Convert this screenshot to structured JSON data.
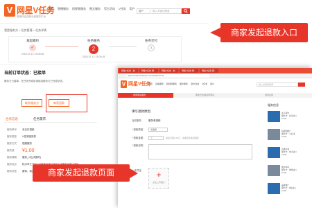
{
  "back": {
    "logo": {
      "badge": "V",
      "text": "网星V任务",
      "tagline": "新媒体自由职业者服务平台"
    },
    "nav": [
      "首页",
      "直播服务",
      "短视频服务",
      "图文服务",
      "官方活动",
      "V任务",
      "用户"
    ],
    "search": {
      "select": "用户",
      "placeholder": "输入关键词搜索"
    },
    "breadcrumb": "我是服务方 > 任务管理 > 任务详情",
    "steps": [
      {
        "title": "发起邀约",
        "num": "✓",
        "time": "2018-07-12 14:06:56",
        "state": "done"
      },
      {
        "title": "任务服务",
        "num": "2",
        "time": "2018-07-12 15:06:18",
        "state": "active"
      },
      {
        "title": "任务交付",
        "num": "3",
        "time": "",
        "state": "todo"
      }
    ],
    "status": {
      "title": "当前订单状态：已接单",
      "desc": "服务方已接单，在任务完成前请保持服务方已完成状态。",
      "contact_btn": "联系服务方",
      "refund_btn": "商家退款"
    },
    "tabs": [
      "合作信息",
      "任务需求"
    ],
    "info": [
      {
        "k": "服务单号",
        "v": "未交付退款"
      },
      {
        "k": "服务类型",
        "v": "V任务服务类"
      },
      {
        "k": "服务方式",
        "v": "视频服务"
      },
      {
        "k": "服务费",
        "v": "¥1.00"
      },
      {
        "k": "服务周期",
        "v": "服务_1天(天数时)"
      },
      {
        "k": "服务地点",
        "v": "杭州市江干区123号杭州市江干区123号杭州市江干区"
      },
      {
        "k": "服务标签",
        "v": "服饰、商品服务(无需要)"
      }
    ]
  },
  "callouts": {
    "top": "商家发起退款入口",
    "bottom": "商家发起退款页面"
  },
  "front": {
    "browser_tabs": [
      "网星V任务 - 新...",
      "网星V任务-网...",
      "网星V任务 - 新...",
      "网星V任务-网...",
      "网星V任务-网..."
    ],
    "url": "https://vtask.kanbeiren.com/task/refund",
    "logo": {
      "badge": "V",
      "text": "网星V任务"
    },
    "nav": [
      "首页",
      "直播服务",
      "短视频服务",
      "图文服务",
      "官方活动",
      "V任务",
      "用户"
    ],
    "search_placeholder": "输入关键词搜索",
    "progress": [
      "商家申请退款",
      "服务方处理退款申请",
      "退款完成"
    ],
    "form": {
      "title": "填写退款原因",
      "fields": [
        {
          "label": "当前服务",
          "value": "服务单退款"
        },
        {
          "label": "* 退款原因",
          "value": "请选择"
        },
        {
          "label": "* 退款金额",
          "value": "元",
          "hint": "最多可退1.00元，请按实际情况填写"
        },
        {
          "label": "* 退款说明",
          "value": ""
        }
      ],
      "upload_label": "上传凭证",
      "upload_text": "点击上传图片"
    },
    "sidebar": {
      "title": "服务信息",
      "items": [
        {
          "line1": "达人服务",
          "line2": "服务方：抖音达人",
          "line3": "¥1.00"
        },
        {
          "line1": "短视频推广",
          "line2": "服务方：小红书",
          "line3": "¥1.00"
        },
        {
          "line1": "直播带货",
          "line2": "服务方：快手达人",
          "line3": "¥1.00"
        },
        {
          "line1": "图文种草",
          "line2": "服务方：微博达人",
          "line3": "¥1.00"
        },
        {
          "line1": "品牌推广",
          "line2": "服务方：B站达人",
          "line3": "¥1.00"
        }
      ]
    }
  },
  "colors": {
    "accent": "#e8352a",
    "brand": "#f26522"
  }
}
